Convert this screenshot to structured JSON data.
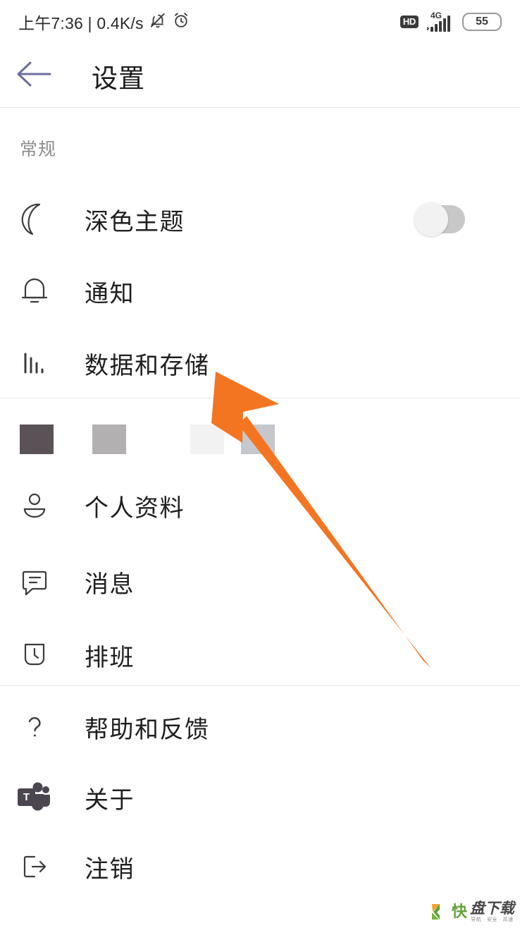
{
  "status_bar": {
    "time_text": "上午7:36 | 0.4K/s",
    "mute_icon": "bell-muted-icon",
    "alarm_icon": "alarm-clock-icon",
    "hd_label": "HD",
    "network_label": "4G",
    "signal_icon": "signal-bars-icon",
    "battery_level": "55"
  },
  "app_bar": {
    "back_icon": "back-arrow-icon",
    "back_color": "#6b6f9e",
    "title": "设置"
  },
  "sections": [
    {
      "label": "常规",
      "items": [
        {
          "icon": "moon-icon",
          "label": "深色主题",
          "control": "toggle",
          "toggle_on": false
        },
        {
          "icon": "bell-icon",
          "label": "通知",
          "control": "none"
        },
        {
          "icon": "bar-chart-icon",
          "label": "数据和存储",
          "control": "none"
        }
      ]
    },
    {
      "label": "",
      "items": [
        {
          "icon": "person-icon",
          "label": "个人资料",
          "control": "none"
        },
        {
          "icon": "chat-bubble-icon",
          "label": "消息",
          "control": "none"
        },
        {
          "icon": "clock-icon",
          "label": "排班",
          "control": "none"
        }
      ]
    },
    {
      "label": "",
      "items": [
        {
          "icon": "question-mark-icon",
          "label": "帮助和反馈",
          "control": "none"
        },
        {
          "icon": "teams-logo-icon",
          "label": "关于",
          "control": "none"
        },
        {
          "icon": "sign-out-icon",
          "label": "注销",
          "control": "none"
        }
      ]
    }
  ],
  "theme_swatches": [
    {
      "name": "swatch-dark",
      "color": "#5b5258"
    },
    {
      "name": "swatch-medium-gray",
      "color": "#b3b0b1"
    },
    {
      "name": "swatch-near-white",
      "color": "#f2f2f3"
    },
    {
      "name": "swatch-light-gray",
      "color": "#c6c7cd"
    }
  ],
  "annotation": {
    "arrow_color": "#f47521",
    "name": "orange-pointer-arrow"
  },
  "watermark": {
    "logo_letter": "K",
    "text_1": "快",
    "text_2": "盘下载",
    "subtitle": "导航 · 安全 · 高速"
  }
}
